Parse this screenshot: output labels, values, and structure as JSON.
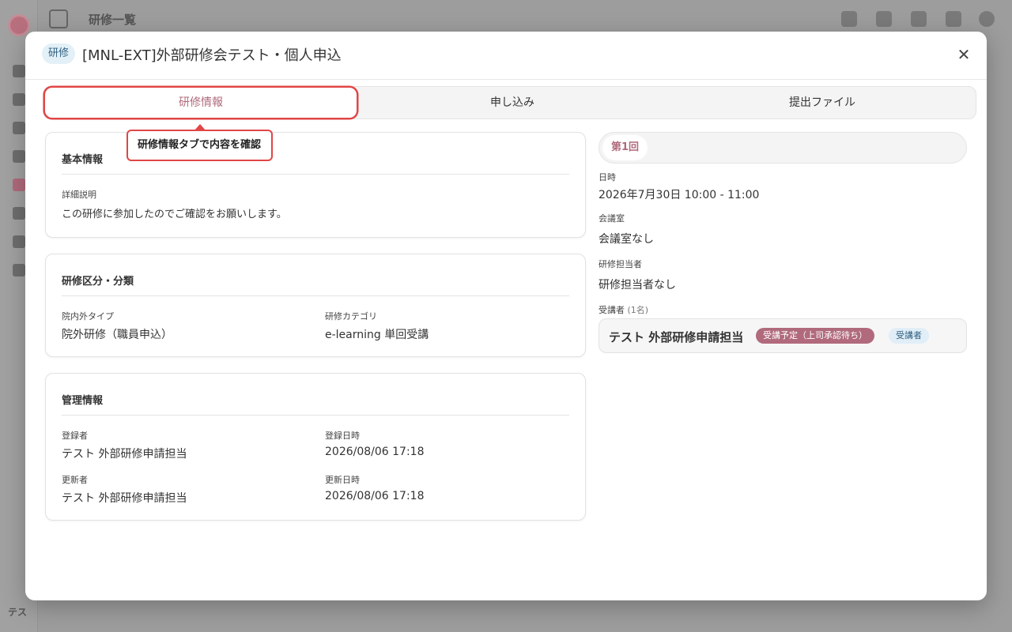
{
  "background": {
    "page_title": "研修一覧",
    "sidebar_footer": "テス"
  },
  "modal": {
    "type_badge": "研修",
    "title": "[MNL-EXT]外部研修会テスト・個人申込",
    "close_icon": "close-icon"
  },
  "tabs": [
    {
      "label": "研修情報",
      "active": true
    },
    {
      "label": "申し込み",
      "active": false
    },
    {
      "label": "提出ファイル",
      "active": false
    }
  ],
  "callout": {
    "text": "研修情報タブで内容を確認"
  },
  "basic_info": {
    "title": "基本情報",
    "description_label": "詳細説明",
    "description_value": "この研修に参加したのでご確認をお願いします。"
  },
  "classification": {
    "title": "研修区分・分類",
    "type_label": "院内外タイプ",
    "type_value": "院外研修（職員申込）",
    "category_label": "研修カテゴリ",
    "category_value": "e-learning 単回受講"
  },
  "management": {
    "title": "管理情報",
    "creator_label": "登録者",
    "creator_value": "テスト 外部研修申請担当",
    "created_label": "登録日時",
    "created_value": "2026/08/06 17:18",
    "updater_label": "更新者",
    "updater_value": "テスト 外部研修申請担当",
    "updated_label": "更新日時",
    "updated_value": "2026/08/06 17:18"
  },
  "session": {
    "tab_label": "第1回",
    "datetime_label": "日時",
    "datetime_value": "2026年7月30日 10:00 - 11:00",
    "room_label": "会議室",
    "room_value": "会議室なし",
    "manager_label": "研修担当者",
    "manager_value": "研修担当者なし",
    "attendees_label": "受講者",
    "attendees_count": "(1名)",
    "attendees": [
      {
        "name": "テスト 外部研修申請担当",
        "status": "受講予定（上司承認待ち）",
        "role": "受講者"
      }
    ]
  },
  "colors": {
    "accent": "#b06a7c",
    "highlight": "#e04646",
    "badge_blue_bg": "#e1eef7"
  }
}
